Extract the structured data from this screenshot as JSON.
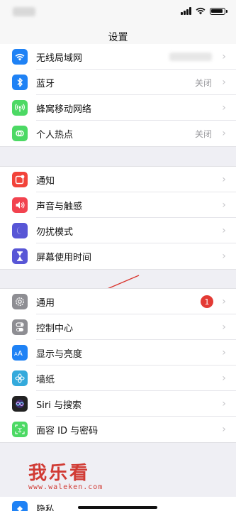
{
  "nav": {
    "title": "设置"
  },
  "group1": [
    {
      "label": "无线局域网",
      "icon": "wifi-icon",
      "color": "#1f82f5"
    },
    {
      "label": "蓝牙",
      "value": "关闭",
      "icon": "bluetooth-icon",
      "color": "#1f82f5"
    },
    {
      "label": "蜂窝移动网络",
      "icon": "cellular-icon",
      "color": "#4cd964"
    },
    {
      "label": "个人热点",
      "value": "关闭",
      "icon": "hotspot-icon",
      "color": "#4cd964"
    }
  ],
  "group2": [
    {
      "label": "通知",
      "icon": "notifications-icon",
      "color": "#f2433a"
    },
    {
      "label": "声音与触感",
      "icon": "sound-icon",
      "color": "#f2434f"
    },
    {
      "label": "勿扰模式",
      "icon": "moon-icon",
      "color": "#5856d6"
    },
    {
      "label": "屏幕使用时间",
      "icon": "hourglass-icon",
      "color": "#5856d6"
    }
  ],
  "group3": [
    {
      "label": "通用",
      "badge": "1",
      "icon": "gear-icon",
      "color": "#8e8e93"
    },
    {
      "label": "控制中心",
      "icon": "toggles-icon",
      "color": "#8e8e93"
    },
    {
      "label": "显示与亮度",
      "icon": "display-icon",
      "color": "#1f82f5"
    },
    {
      "label": "墙纸",
      "icon": "wallpaper-icon",
      "color": "#34aadc"
    },
    {
      "label": "Siri 与搜索",
      "icon": "siri-icon",
      "color": "#222222"
    },
    {
      "label": "面容 ID 与密码",
      "icon": "faceid-icon",
      "color": "#4cd964"
    }
  ],
  "group4": [
    {
      "label": "隐私",
      "icon": "privacy-icon",
      "color": "#1f82f5"
    }
  ],
  "watermark": {
    "title": "我乐看",
    "url": "www.waleken.com"
  },
  "chevron": "›"
}
